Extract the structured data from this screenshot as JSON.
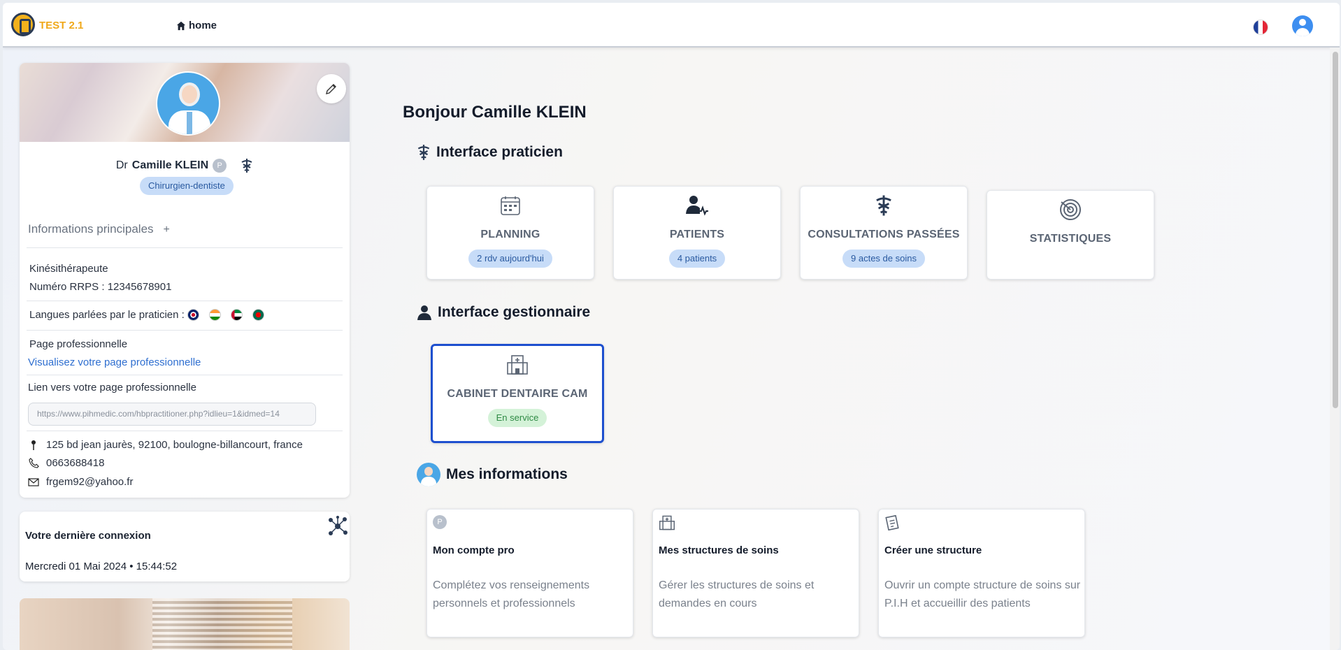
{
  "header": {
    "brand": "TEST 2.1",
    "home_label": "home"
  },
  "profile": {
    "title_prefix": "Dr",
    "name": "Camille KLEIN",
    "p_badge": "P",
    "specialty": "Chirurgien-dentiste",
    "info_heading": "Informations principales",
    "info_plus": "+",
    "profession": "Kinésithérapeute",
    "rrps": "Numéro RRPS : 12345678901",
    "languages_label": "Langues parlées par le praticien :",
    "languages": [
      "English",
      "Hindi",
      "Arabic",
      "Bengali"
    ],
    "pro_page_label": "Page professionnelle",
    "pro_page_link": "Visualisez votre page professionnelle",
    "pro_link_label": "Lien vers votre page professionnelle",
    "pro_link_value": "https://www.pihmedic.com/hbpractitioner.php?idlieu=1&idmed=14",
    "address": "125 bd jean jaurès, 92100, boulogne-billancourt, france",
    "phone": "0663688418",
    "email": "frgem92@yahoo.fr"
  },
  "last_connection": {
    "title": "Votre dernière connexion",
    "date": "Mercredi 01 Mai 2024 • 15:44:52"
  },
  "main": {
    "greeting": "Bonjour Camille KLEIN",
    "practitioner_section": "Interface praticien",
    "manager_section": "Interface gestionnaire",
    "info_section": "Mes informations",
    "tiles": [
      {
        "label": "PLANNING",
        "badge": "2 rdv aujourd'hui",
        "icon": "calendar-icon"
      },
      {
        "label": "PATIENTS",
        "badge": "4 patients",
        "icon": "patient-icon"
      },
      {
        "label": "CONSULTATIONS PASSÉES",
        "badge": "9 actes de soins",
        "icon": "caduceus-icon"
      },
      {
        "label": "STATISTIQUES",
        "badge": "",
        "icon": "stats-icon"
      }
    ],
    "structure": {
      "label": "CABINET DENTAIRE CAM",
      "badge": "En service",
      "icon": "hospital-icon"
    },
    "info_cards": [
      {
        "title": "Mon compte pro",
        "desc": "Complétez vos renseignements personnels et professionnels",
        "icon": "p-badge-icon"
      },
      {
        "title": "Mes structures de soins",
        "desc": "Gérer les structures de soins et demandes en cours",
        "icon": "hospital-icon"
      },
      {
        "title": "Créer une structure",
        "desc": "Ouvrir un compte structure de soins sur P.I.H et accueillir des patients",
        "icon": "document-icon"
      }
    ]
  },
  "colors": {
    "brand": "#f0a81a",
    "accent": "#1d4fcf",
    "badge_bg": "#c7dcf8",
    "success_bg": "#d4f2d8"
  }
}
